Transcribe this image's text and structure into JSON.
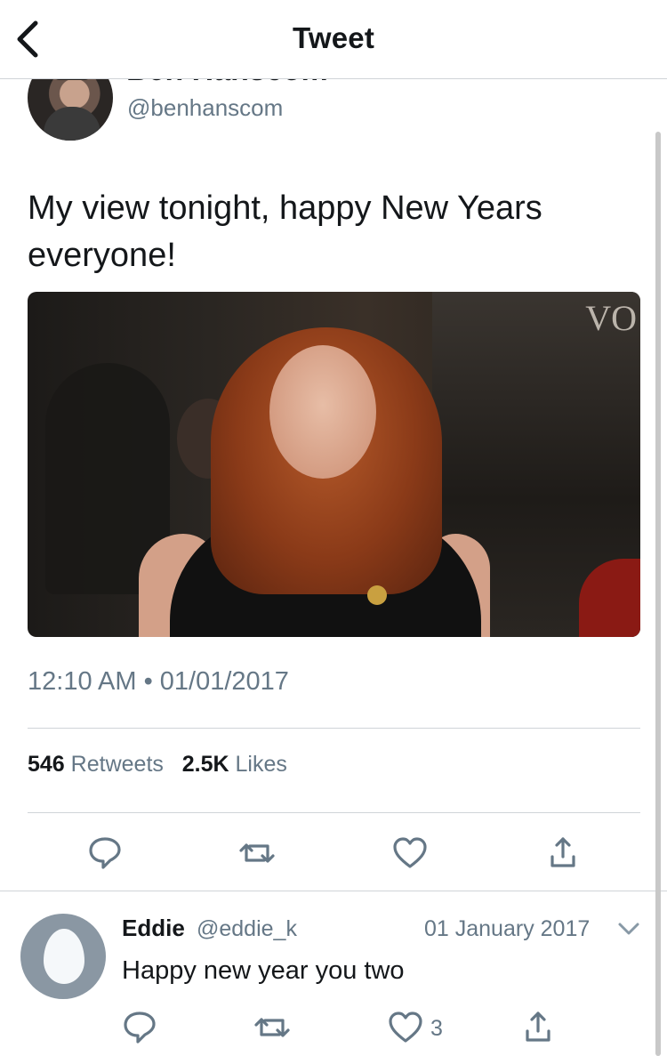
{
  "nav": {
    "title": "Tweet"
  },
  "author": {
    "name": "Ben Hanscom",
    "handle": "@benhanscom"
  },
  "tweet": {
    "text": "My view tonight, happy New Years everyone!",
    "media_watermark": "VO",
    "timestamp": "12:10 AM • 01/01/2017"
  },
  "stats": {
    "retweets_count": "546",
    "retweets_label": "Retweets",
    "likes_count": "2.5K",
    "likes_label": "Likes"
  },
  "reply": {
    "name": "Eddie",
    "handle": "@eddie_k",
    "date": "01 January 2017",
    "text": "Happy new year you two",
    "like_count": "3"
  },
  "colors": {
    "icon": "#657786",
    "accent": "#1da1f2",
    "divider": "#d0d4d8"
  },
  "icons": [
    "back-icon",
    "reply-icon",
    "retweet-icon",
    "like-icon",
    "share-icon",
    "chevron-down-icon",
    "egg-avatar-icon"
  ]
}
